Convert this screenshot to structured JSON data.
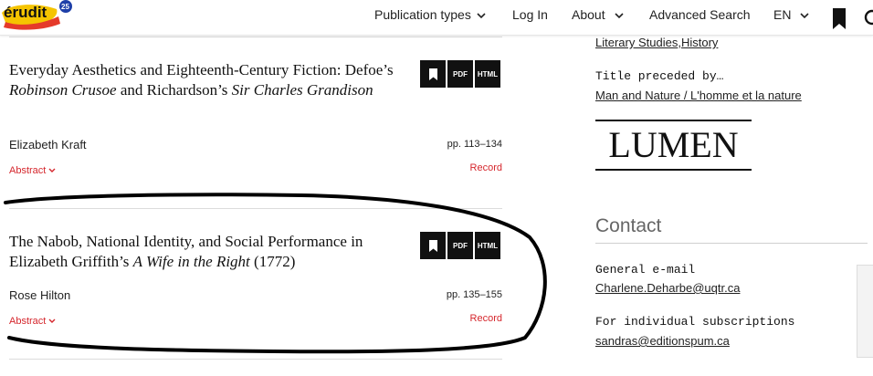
{
  "brand": {
    "name": "érudit",
    "badge": "25"
  },
  "nav": {
    "publication_types": "Publication types",
    "login": "Log In",
    "about": "About",
    "advanced_search": "Advanced Search",
    "language": "EN"
  },
  "articles": [
    {
      "title_before": "Everyday Aesthetics and Eighteenth-Century Fiction: Defoe’s ",
      "title_em1": "Robinson Crusoe",
      "title_mid": " and Richardson’s ",
      "title_em2": "Sir Charles Grandison",
      "title_after": "",
      "author": "Elizabeth Kraft",
      "pages": "pp. 113–134",
      "abstract": "Abstract",
      "record": "Record",
      "pdf": "PDF",
      "html": "HTML"
    },
    {
      "title_before": "The Nabob, National Identity, and Social Performance in Elizabeth Griffith’s ",
      "title_em1": "A Wife in the Right",
      "title_mid": " (1772)",
      "title_em2": "",
      "title_after": "",
      "author": "Rose Hilton",
      "pages": "pp. 135–155",
      "abstract": "Abstract",
      "record": "Record",
      "pdf": "PDF",
      "html": "HTML"
    }
  ],
  "sidebar": {
    "discipline_1": "Literary Studies",
    "discipline_sep": ", ",
    "discipline_2": "History",
    "preceded_label": "Title preceded by…",
    "preceded_link": "Man and Nature / L'homme et la nature",
    "lumen_logo_text": "LUMEN",
    "contact_heading": "Contact",
    "general_email_label": "General e-mail",
    "general_email": "Charlene.Deharbe@uqtr.ca",
    "subscriptions_label": "For individual subscriptions",
    "subscriptions_email": "sandras@editionspum.ca"
  },
  "colors": {
    "accent_red": "#d5262c",
    "text": "#111111",
    "annotation": "#000000"
  },
  "icons": [
    "chevron-down-icon",
    "bookmark-icon",
    "search-icon"
  ]
}
